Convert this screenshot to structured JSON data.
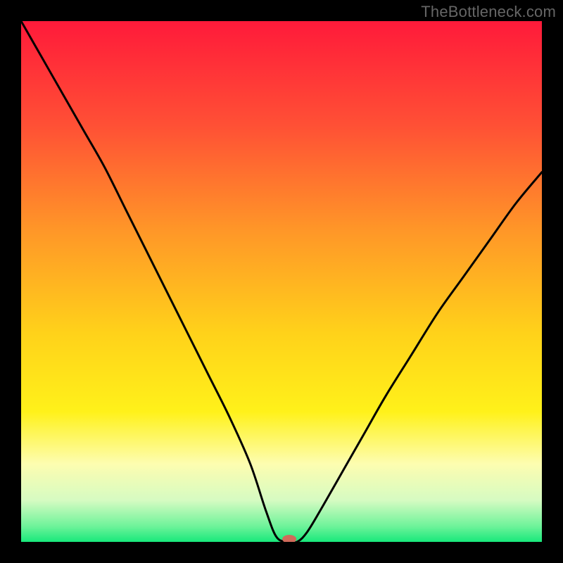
{
  "watermark": "TheBottleneck.com",
  "chart_data": {
    "type": "line",
    "title": "",
    "xlabel": "",
    "ylabel": "",
    "xlim": [
      0,
      100
    ],
    "ylim": [
      0,
      100
    ],
    "grid": false,
    "legend": false,
    "background_gradient": {
      "stops": [
        {
          "offset": 0.0,
          "color": "#ff1a3a"
        },
        {
          "offset": 0.2,
          "color": "#ff5035"
        },
        {
          "offset": 0.4,
          "color": "#ff9628"
        },
        {
          "offset": 0.6,
          "color": "#ffd21a"
        },
        {
          "offset": 0.75,
          "color": "#fff11a"
        },
        {
          "offset": 0.85,
          "color": "#fdfdb0"
        },
        {
          "offset": 0.92,
          "color": "#d6fbc2"
        },
        {
          "offset": 0.97,
          "color": "#6ef39a"
        },
        {
          "offset": 1.0,
          "color": "#18e87b"
        }
      ]
    },
    "series": [
      {
        "name": "bottleneck-curve",
        "x": [
          0,
          4,
          8,
          12,
          16,
          20,
          24,
          28,
          32,
          36,
          40,
          44,
          47,
          49,
          51,
          53,
          55,
          58,
          62,
          66,
          70,
          75,
          80,
          85,
          90,
          95,
          100
        ],
        "y": [
          100,
          93,
          86,
          79,
          72,
          64,
          56,
          48,
          40,
          32,
          24,
          15,
          6,
          1,
          0,
          0,
          2,
          7,
          14,
          21,
          28,
          36,
          44,
          51,
          58,
          65,
          71
        ]
      }
    ],
    "marker": {
      "name": "bottleneck-marker",
      "x": 51.5,
      "y": 0,
      "color": "#d06a5a",
      "rx": 10,
      "ry": 6
    }
  }
}
